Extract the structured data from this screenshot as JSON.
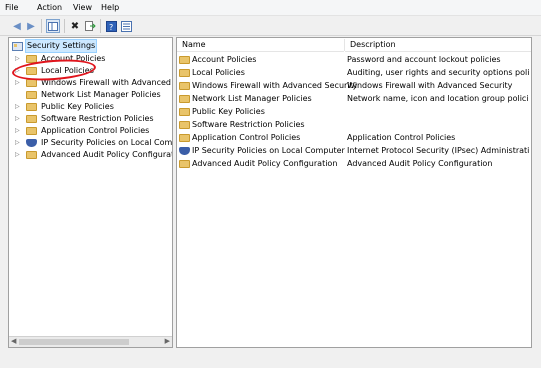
{
  "menu": [
    "File",
    "Action",
    "View",
    "Help"
  ],
  "toolbar": {
    "icons": [
      "back-arrow-icon",
      "forward-arrow-icon",
      "show-hide-tree-icon",
      "delete-icon",
      "export-list-icon",
      "help-icon",
      "properties-icon"
    ]
  },
  "tree": {
    "root": "Security Settings",
    "items": [
      {
        "label": "Account Policies",
        "icon": "folder-icon"
      },
      {
        "label": "Local Policies",
        "icon": "folder-icon"
      },
      {
        "label": "Windows Firewall with Advanced Secu",
        "icon": "folder-icon"
      },
      {
        "label": "Network List Manager Policies",
        "icon": "folder-icon"
      },
      {
        "label": "Public Key Policies",
        "icon": "folder-icon"
      },
      {
        "label": "Software Restriction Policies",
        "icon": "folder-icon"
      },
      {
        "label": "Application Control Policies",
        "icon": "folder-icon"
      },
      {
        "label": "IP Security Policies on Local Compute",
        "icon": "shield-icon"
      },
      {
        "label": "Advanced Audit Policy Configuration",
        "icon": "folder-icon"
      }
    ]
  },
  "list": {
    "columns": [
      "Name",
      "Description"
    ],
    "rows": [
      {
        "name": "Account Policies",
        "desc": "Password and account lockout policies"
      },
      {
        "name": "Local Policies",
        "desc": "Auditing, user rights and security options polici..."
      },
      {
        "name": "Windows Firewall with Advanced Security",
        "desc": "Windows Firewall with Advanced Security"
      },
      {
        "name": "Network List Manager Policies",
        "desc": "Network name, icon and location group policies."
      },
      {
        "name": "Public Key Policies",
        "desc": ""
      },
      {
        "name": "Software Restriction Policies",
        "desc": ""
      },
      {
        "name": "Application Control Policies",
        "desc": "Application Control Policies"
      },
      {
        "name": "IP Security Policies on Local Computer",
        "desc": "Internet Protocol Security (IPsec) Administratio..."
      },
      {
        "name": "Advanced Audit Policy Configuration",
        "desc": "Advanced Audit Policy Configuration"
      }
    ]
  },
  "colors": {
    "annotation": "#e0141c",
    "folder": "#e9c46a",
    "selection": "#cce8ff"
  }
}
